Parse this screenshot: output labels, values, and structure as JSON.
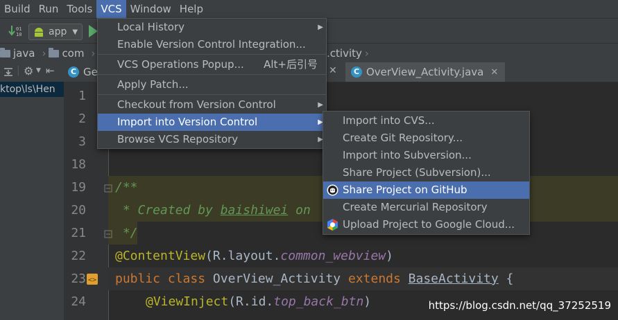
{
  "menubar": {
    "items": [
      {
        "label": "Build",
        "mn": "B"
      },
      {
        "label": "Run",
        "mn": "u"
      },
      {
        "label": "Tools",
        "mn": "T"
      },
      {
        "label": "VCS",
        "mn": "S"
      },
      {
        "label": "Window",
        "mn": "W"
      },
      {
        "label": "Help",
        "mn": "H"
      }
    ]
  },
  "toolbar": {
    "run_config": "app"
  },
  "breadcrumb": [
    "java",
    "com",
    "...ctivity"
  ],
  "tabs": {
    "left_tab": "Ge",
    "right_tab": "OverView_Activity.java"
  },
  "project_panel": {
    "selected_path": "ktop\\ls\\Hen"
  },
  "vcs_menu": {
    "items": [
      {
        "label": "Local History",
        "has_submenu": true
      },
      {
        "label": "Enable Version Control Integration...",
        "has_submenu": false
      },
      {
        "label": "VCS Operations Popup...",
        "shortcut": "Alt+后引号",
        "has_submenu": false
      },
      {
        "label": "Apply Patch...",
        "has_submenu": false
      },
      {
        "label": "Checkout from Version Control",
        "has_submenu": true
      },
      {
        "label": "Import into Version Control",
        "has_submenu": true,
        "selected": true
      },
      {
        "label": "Browse VCS Repository",
        "has_submenu": true
      }
    ]
  },
  "import_submenu": {
    "items": [
      {
        "label": "Import into CVS..."
      },
      {
        "label": "Create Git Repository..."
      },
      {
        "label": "Import into Subversion..."
      },
      {
        "label": "Share Project (Subversion)..."
      },
      {
        "label": "Share Project on GitHub",
        "selected": true,
        "icon": "github-icon"
      },
      {
        "label": "Create Mercurial Repository"
      },
      {
        "label": "Upload Project to Google Cloud...",
        "icon": "google-cloud-icon"
      }
    ]
  },
  "editor": {
    "line_numbers": [
      "1",
      "2",
      "3",
      "18",
      "19",
      "20",
      "21",
      "22",
      "23",
      "24"
    ],
    "code": {
      "l19": "/**",
      "l20_prefix": " * Created by ",
      "l20_author": "baishiwei",
      "l20_suffix": " on ",
      "l21": " */",
      "l22_ann": "@ContentView",
      "l22_mid": "(R.layout.",
      "l22_field": "common_webview",
      "l22_end": ")",
      "l23_kw1": "public class ",
      "l23_name": "OverView_Activity ",
      "l23_kw2": "extends ",
      "l23_base": "BaseActivity",
      "l23_end": " {",
      "l24_ann": "@ViewInject",
      "l24_mid": "(R.id.",
      "l24_field": "top_back_btn",
      "l24_end": ")"
    }
  },
  "watermark": "https://blog.csdn.net/qq_37252519",
  "colors": {
    "menu_bg": "#3c3f41",
    "selection": "#4b6eaf",
    "editor_bg": "#2b2b2b"
  }
}
